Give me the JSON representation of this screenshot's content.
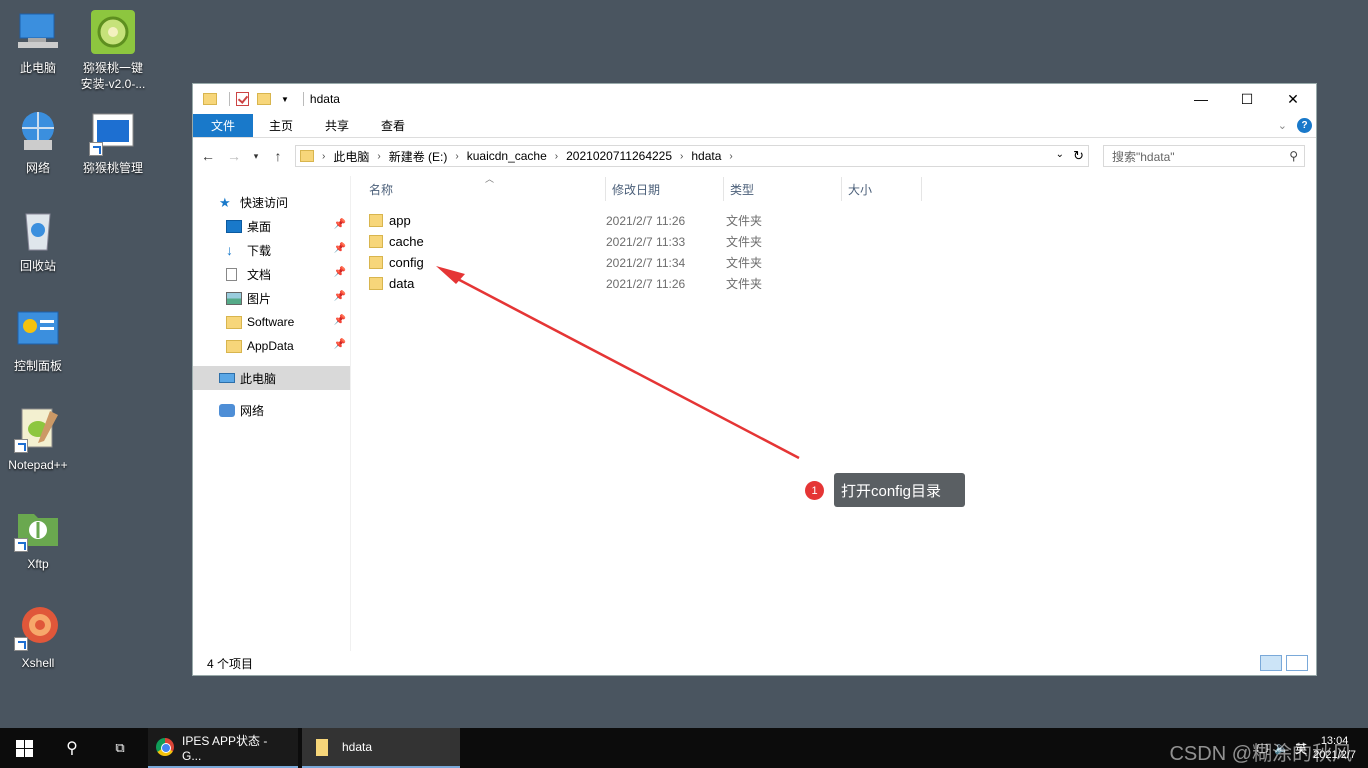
{
  "desktop": {
    "icons": [
      {
        "label": "此电脑"
      },
      {
        "label": "猕猴桃一键\n安装-v2.0-..."
      },
      {
        "label": "网络"
      },
      {
        "label": "猕猴桃管理"
      },
      {
        "label": "回收站"
      },
      {
        "label": "控制面板"
      },
      {
        "label": "Notepad++"
      },
      {
        "label": "Xftp"
      },
      {
        "label": "Xshell"
      }
    ]
  },
  "window": {
    "title": "hdata",
    "controls": {
      "minimize": "—",
      "maximize": "☐",
      "close": "✕"
    },
    "ribbon": {
      "tabs": [
        "文件",
        "主页",
        "共享",
        "查看"
      ],
      "help": "?"
    },
    "address": {
      "crumbs": [
        "此电脑",
        "新建卷 (E:)",
        "kuaicdn_cache",
        "2021020711264225",
        "hdata"
      ]
    },
    "search": {
      "placeholder": "搜索\"hdata\""
    },
    "navpane": {
      "quick_access": "快速访问",
      "items": [
        {
          "label": "桌面",
          "pinned": true
        },
        {
          "label": "下载",
          "pinned": true
        },
        {
          "label": "文档",
          "pinned": true
        },
        {
          "label": "图片",
          "pinned": true
        },
        {
          "label": "Software",
          "pinned": true
        },
        {
          "label": "AppData",
          "pinned": true
        }
      ],
      "this_pc": "此电脑",
      "network": "网络"
    },
    "columns": [
      "名称",
      "修改日期",
      "类型",
      "大小"
    ],
    "files": [
      {
        "name": "app",
        "date": "2021/2/7 11:26",
        "type": "文件夹"
      },
      {
        "name": "cache",
        "date": "2021/2/7 11:33",
        "type": "文件夹"
      },
      {
        "name": "config",
        "date": "2021/2/7 11:34",
        "type": "文件夹"
      },
      {
        "name": "data",
        "date": "2021/2/7 11:26",
        "type": "文件夹"
      }
    ],
    "status": "4 个项目"
  },
  "annotation": {
    "number": "1",
    "text": "打开config目录",
    "color": "#e53535"
  },
  "taskbar": {
    "apps": [
      {
        "label": "IPES APP状态 - G..."
      },
      {
        "label": "hdata"
      }
    ],
    "tray": {
      "ime": "英",
      "time": "13:04",
      "date": "2021/2/7"
    },
    "watermark": "CSDN @糊涂的秋风"
  }
}
